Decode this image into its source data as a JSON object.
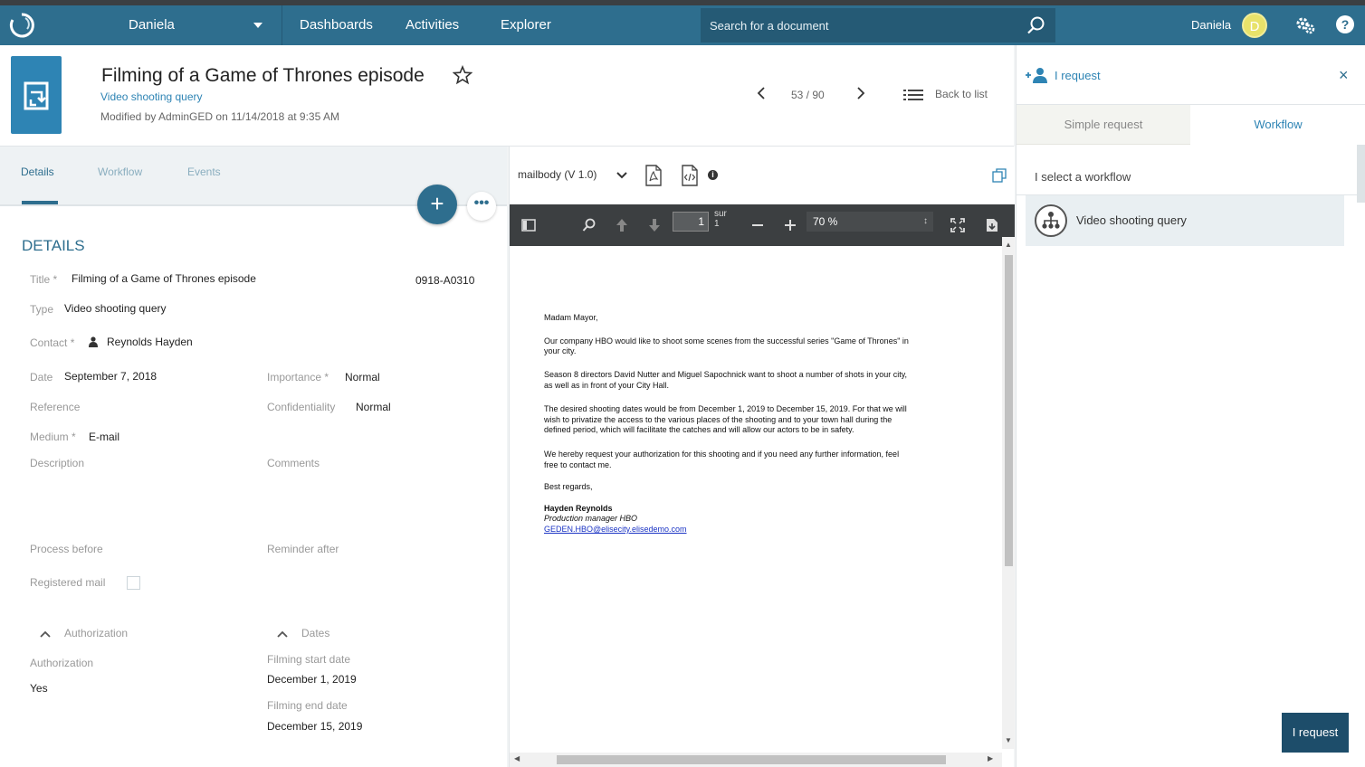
{
  "nav": {
    "user_menu": "Daniela",
    "items": [
      "Dashboards",
      "Activities",
      "Explorer"
    ],
    "search_placeholder": "Search for a document",
    "user_name": "Daniela",
    "avatar_letter": "D",
    "help": "?"
  },
  "document": {
    "title": "Filming of a Game of Thrones episode",
    "type_link": "Video shooting query",
    "modified": "Modified by AdminGED on 11/14/2018 at 9:35 AM"
  },
  "pager": {
    "text": "53 / 90",
    "back_label": "Back to list"
  },
  "tabs": [
    "Details",
    "Workflow",
    "Events"
  ],
  "fab_plus": "+",
  "fab_more": "•••",
  "details": {
    "section": "DETAILS",
    "title_label": "Title *",
    "title_value": "Filming of a Game of Thrones episode",
    "ref_code": "0918-A0310",
    "type_label": "Type",
    "type_value": "Video shooting query",
    "contact_label": "Contact *",
    "contact_value": "Reynolds Hayden",
    "date_label": "Date",
    "date_value": "September 7, 2018",
    "importance_label": "Importance *",
    "importance_value": "Normal",
    "reference_label": "Reference",
    "confidentiality_label": "Confidentiality",
    "confidentiality_value": "Normal",
    "medium_label": "Medium *",
    "medium_value": "E-mail",
    "description_label": "Description",
    "comments_label": "Comments",
    "process_before_label": "Process before",
    "reminder_after_label": "Reminder after",
    "registered_mail_label": "Registered mail",
    "auth_group": "Authorization",
    "auth_label": "Authorization",
    "auth_value": "Yes",
    "dates_group": "Dates",
    "film_start_label": "Filming start date",
    "film_start_value": "December 1, 2019",
    "film_end_label": "Filming end date",
    "film_end_value": "December 15, 2019"
  },
  "viewer": {
    "file_label": "mailbody (V 1.0)",
    "page_value": "1",
    "sur_label": "sur",
    "sur_total": "1",
    "zoom": "70 %",
    "letter": {
      "greeting": "Madam Mayor,",
      "p1a": "Our company HBO would like to shoot some scenes from the successful series \"Game of Thrones\" in",
      "p1b": "your city.",
      "p2a": "Season 8 directors David Nutter and Miguel Sapochnick want to shoot a number of shots in your city,",
      "p2b": "as well as in front of your City Hall.",
      "p3a": "The desired shooting dates would be from December 1, 2019 to December 15, 2019. For that we will",
      "p3b": "wish to privatize the access to the various places of the shooting and to your town hall during the",
      "p3c": "defined period, which will facilitate the catches and will allow our actors to be in safety.",
      "p4a": "We hereby request your authorization for this shooting and if you need any further information, feel",
      "p4b": "free to contact me.",
      "closing": "Best regards,",
      "signer": "Hayden Reynolds",
      "role": "Production manager HBO",
      "email": "GEDEN.HBO@elisecity.elisedemo.com"
    }
  },
  "right_panel": {
    "title": "I request",
    "close": "×",
    "tab_simple": "Simple request",
    "tab_workflow": "Workflow",
    "select_label": "I select a workflow",
    "workflow_item": "Video shooting query",
    "request_button": "I request"
  },
  "colors": {
    "nav_bg": "#2e6e8e",
    "accent": "#2e84b4",
    "fab": "#2e6e8e",
    "button_dark": "#1d4d6a"
  }
}
